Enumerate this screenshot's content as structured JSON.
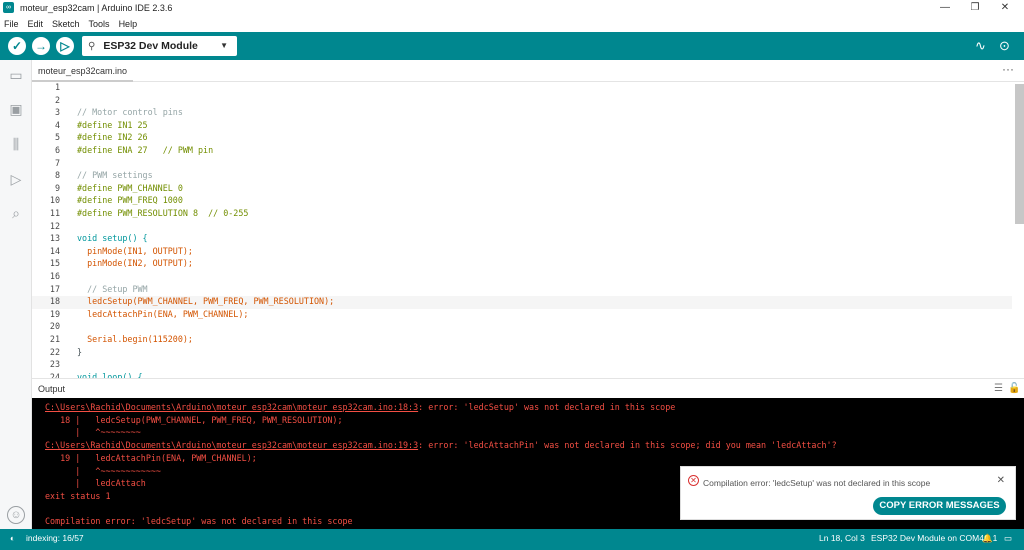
{
  "window": {
    "title": "moteur_esp32cam | Arduino IDE 2.3.6",
    "app_icon": "∞",
    "minimize": "—",
    "maximize": "❐",
    "close": "✕"
  },
  "menu": [
    "File",
    "Edit",
    "Sketch",
    "Tools",
    "Help"
  ],
  "toolbar": {
    "verify_icon": "✓",
    "upload_icon": "→",
    "debug_icon": "▷",
    "usb_icon": "⚲",
    "board": "ESP32 Dev Module",
    "board_caret": "▼",
    "serial_plotter_icon": "∿",
    "serial_monitor_icon": "⊙",
    "accent": "#00878f"
  },
  "sidebar": {
    "folder_icon": "▭",
    "board_icon": "▣",
    "library_icon": "⫼",
    "debug_icon": "▷",
    "search_icon": "⌕",
    "account_icon": "☺"
  },
  "tab": {
    "file": "moteur_esp32cam.ino",
    "more": "···"
  },
  "code": [
    {
      "n": "1",
      "t": ""
    },
    {
      "n": "2",
      "t": ""
    },
    {
      "n": "3",
      "t": "// Motor control pins"
    },
    {
      "n": "4",
      "t": "#define IN1 25"
    },
    {
      "n": "5",
      "t": "#define IN2 26"
    },
    {
      "n": "6",
      "t": "#define ENA 27   // PWM pin"
    },
    {
      "n": "7",
      "t": ""
    },
    {
      "n": "8",
      "t": "// PWM settings"
    },
    {
      "n": "9",
      "t": "#define PWM_CHANNEL 0"
    },
    {
      "n": "10",
      "t": "#define PWM_FREQ 1000"
    },
    {
      "n": "11",
      "t": "#define PWM_RESOLUTION 8  // 0-255"
    },
    {
      "n": "12",
      "t": ""
    },
    {
      "n": "13",
      "t": "void setup() {"
    },
    {
      "n": "14",
      "t": "  pinMode(IN1, OUTPUT);"
    },
    {
      "n": "15",
      "t": "  pinMode(IN2, OUTPUT);"
    },
    {
      "n": "16",
      "t": ""
    },
    {
      "n": "17",
      "t": "  // Setup PWM"
    },
    {
      "n": "18",
      "t": "  ledcSetup(PWM_CHANNEL, PWM_FREQ, PWM_RESOLUTION);"
    },
    {
      "n": "19",
      "t": "  ledcAttachPin(ENA, PWM_CHANNEL);"
    },
    {
      "n": "20",
      "t": ""
    },
    {
      "n": "21",
      "t": "  Serial.begin(115200);"
    },
    {
      "n": "22",
      "t": "}"
    },
    {
      "n": "23",
      "t": ""
    },
    {
      "n": "24",
      "t": "void loop() {"
    }
  ],
  "output": {
    "label": "Output",
    "clear_icon": "☰",
    "lock_icon": "🔓",
    "lines": [
      {
        "pre": "",
        "link": "C:\\Users\\Rachid\\Documents\\Arduino\\moteur_esp32cam\\moteur_esp32cam.ino:18:3",
        "post": ": error: 'ledcSetup' was not declared in this scope"
      },
      {
        "pre": "   18 |   ledcSetup(PWM_CHANNEL, PWM_FREQ, PWM_RESOLUTION);",
        "link": "",
        "post": ""
      },
      {
        "pre": "      |   ^~~~~~~~~",
        "link": "",
        "post": ""
      },
      {
        "pre": "",
        "link": "C:\\Users\\Rachid\\Documents\\Arduino\\moteur_esp32cam\\moteur_esp32cam.ino:19:3",
        "post": ": error: 'ledcAttachPin' was not declared in this scope; did you mean 'ledcAttach'?"
      },
      {
        "pre": "   19 |   ledcAttachPin(ENA, PWM_CHANNEL);",
        "link": "",
        "post": ""
      },
      {
        "pre": "      |   ^~~~~~~~~~~~~",
        "link": "",
        "post": ""
      },
      {
        "pre": "      |   ledcAttach",
        "link": "",
        "post": ""
      },
      {
        "pre": "exit status 1",
        "link": "",
        "post": ""
      },
      {
        "pre": "",
        "link": "",
        "post": ""
      },
      {
        "pre": "Compilation error: 'ledcSetup' was not declared in this scope",
        "link": "",
        "post": ""
      }
    ]
  },
  "toast": {
    "icon": "✕",
    "message": "Compilation error: 'ledcSetup' was not declared in this scope",
    "close": "✕",
    "button": "COPY ERROR MESSAGES"
  },
  "status": {
    "indexing": "indexing: 16/57",
    "spinner": "◐",
    "position": "Ln 18, Col 3",
    "board_port": "ESP32 Dev Module on COM4",
    "notif": "🔔1",
    "layout_icon": "▭"
  }
}
